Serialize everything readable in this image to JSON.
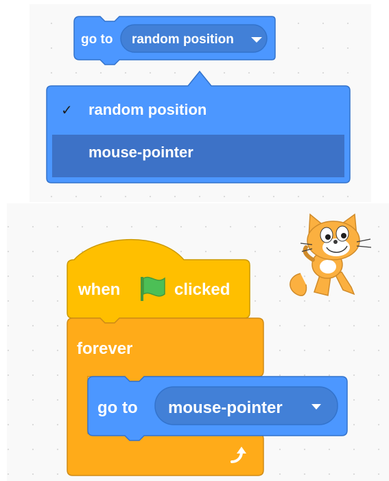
{
  "top_example": {
    "block": {
      "prefix": "go to",
      "dropdown_value": "random position"
    },
    "menu": {
      "check_glyph": "✓",
      "options": [
        {
          "label": "random position",
          "selected": true
        },
        {
          "label": "mouse-pointer",
          "selected": false,
          "highlighted": true
        }
      ]
    }
  },
  "bottom_example": {
    "hat": {
      "prefix": "when",
      "flag_icon": "green-flag-icon",
      "suffix": "clicked"
    },
    "loop": {
      "label": "forever",
      "repeat_icon": "loop-arrow-icon"
    },
    "inner_block": {
      "prefix": "go to",
      "dropdown_value": "mouse-pointer"
    },
    "sprite": "scratch-cat"
  },
  "colors": {
    "motion": "#4c97ff",
    "motion_border": "#3373cc",
    "menu_highlight": "#3d72c7",
    "events": "#ffbf00",
    "control": "#ffab19",
    "control_border": "#cf8b17",
    "flag": "#4cbf56"
  }
}
